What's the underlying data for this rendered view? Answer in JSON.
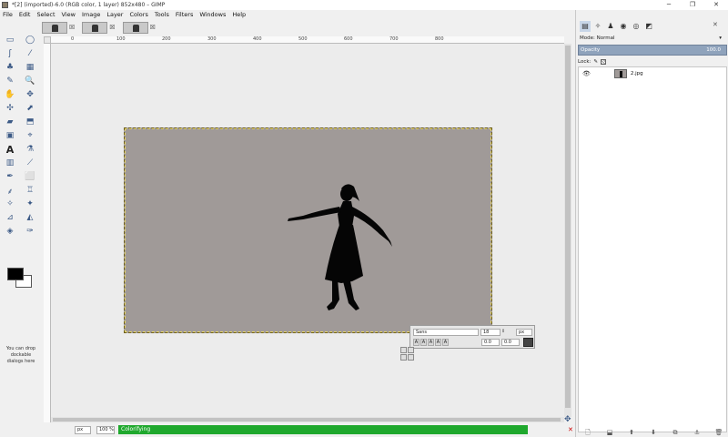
{
  "window": {
    "title": "*[2] (imported)-6.0 (RGB color, 1 layer) 852x480 – GIMP",
    "controls": [
      "─",
      "❐",
      "✕"
    ]
  },
  "menu": [
    "File",
    "Edit",
    "Select",
    "View",
    "Image",
    "Layer",
    "Colors",
    "Tools",
    "Filters",
    "Windows",
    "Help"
  ],
  "tabs": {
    "close_symbol": "☒"
  },
  "ruler": {
    "ticks": [
      "0",
      "100",
      "200",
      "300",
      "400",
      "500",
      "600",
      "700",
      "800"
    ]
  },
  "toolbox": {
    "tools": [
      "▭",
      "◯",
      "ʃ",
      "⁄",
      "♣",
      "▦",
      "✎",
      "🔍",
      "✋",
      "✥",
      "✣",
      "⬈",
      "▰",
      "⬒",
      "▣",
      "⌖",
      "A",
      "⚗",
      "▥",
      "⟋",
      "✒",
      "⬜",
      "⸙",
      "♖",
      "✧",
      "✦",
      "⊿",
      "◭",
      "◈",
      "✑"
    ],
    "drop_hint": "You can drop dockable dialogs here"
  },
  "text_overlay": {
    "font": "Sans",
    "size": "18",
    "unit": "px",
    "style_buttons": [
      "A",
      "A",
      "A",
      "A",
      "A"
    ],
    "baseline": "0.0",
    "kerning": "0.0",
    "color": "#444444"
  },
  "statusbar": {
    "unit": "px",
    "zoom": "100 %",
    "progress_text": "Colorifying",
    "progress": 1.0,
    "close": "✕",
    "progress_color": "#1fa82d"
  },
  "dock": {
    "icons": [
      "▤",
      "✧",
      "♟",
      "◉",
      "◎",
      "◩"
    ],
    "close": "✕",
    "mode_label": "Mode: Normal",
    "opacity_label": "Opacity",
    "opacity_value": "100.0",
    "lock_label": "Lock:",
    "layers": [
      {
        "name": "2.jpg",
        "visible": true
      }
    ],
    "layer_buttons": [
      "🗋",
      "⬓",
      "⬆",
      "⬇",
      "⧉",
      "⚓",
      "🗑"
    ]
  },
  "canvas": {
    "background": "#a09a98"
  }
}
